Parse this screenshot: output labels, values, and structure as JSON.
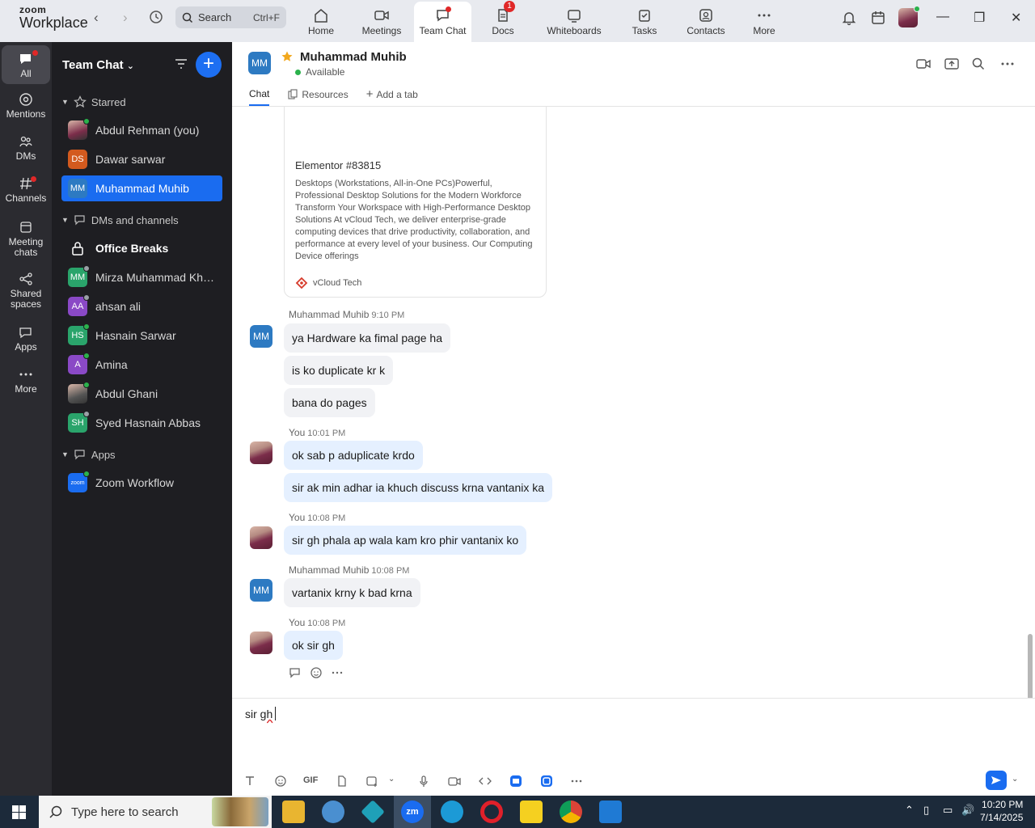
{
  "app": {
    "logo_top": "zoom",
    "logo_bottom": "Workplace"
  },
  "search": {
    "label": "Search",
    "shortcut": "Ctrl+F"
  },
  "nav": {
    "home": "Home",
    "meetings": "Meetings",
    "team_chat": "Team Chat",
    "docs": "Docs",
    "docs_badge": "1",
    "whiteboards": "Whiteboards",
    "tasks": "Tasks",
    "contacts": "Contacts",
    "more": "More"
  },
  "rail": {
    "all": "All",
    "mentions": "Mentions",
    "dms": "DMs",
    "channels": "Channels",
    "meeting_chats": "Meeting chats",
    "shared_spaces": "Shared spaces",
    "apps": "Apps",
    "more": "More"
  },
  "sidebar": {
    "title": "Team Chat",
    "starred_label": "Starred",
    "dms_label": "DMs and channels",
    "apps_label": "Apps",
    "starred": [
      {
        "initials": "",
        "name": "Abdul Rehman (you)",
        "color": "#7b2d4a",
        "status": "#2bb24c"
      },
      {
        "initials": "DS",
        "name": "Dawar sarwar",
        "color": "#d35a1e",
        "status": ""
      },
      {
        "initials": "MM",
        "name": "Muhammad Muhib",
        "color": "#2d7ac2",
        "status": ""
      }
    ],
    "dms": [
      {
        "initials": "",
        "name": "Office Breaks",
        "color": "",
        "status": ""
      },
      {
        "initials": "MM",
        "name": "Mirza Muhammad Khurram",
        "color": "#2aa46b",
        "status": "#9aa0a6"
      },
      {
        "initials": "AA",
        "name": "ahsan ali",
        "color": "#8a49c6",
        "status": "#9aa0a6"
      },
      {
        "initials": "HS",
        "name": "Hasnain Sarwar",
        "color": "#2aa46b",
        "status": "#2bb24c"
      },
      {
        "initials": "A",
        "name": "Amina",
        "color": "#8a49c6",
        "status": "#2bb24c"
      },
      {
        "initials": "",
        "name": "Abdul Ghani",
        "color": "#555",
        "status": "#2bb24c"
      },
      {
        "initials": "SH",
        "name": "Syed Hasnain Abbas",
        "color": "#2aa46b",
        "status": "#9aa0a6"
      }
    ],
    "apps": [
      {
        "initials": "zoom",
        "name": "Zoom Workflow",
        "color": "#1a6cf0",
        "status": "#2bb24c"
      }
    ]
  },
  "channel": {
    "initials": "MM",
    "name": "Muhammad Muhib",
    "status": "Available",
    "tabs": {
      "chat": "Chat",
      "resources": "Resources",
      "add_tab": "Add a tab"
    }
  },
  "card": {
    "title": "Elementor #83815",
    "description": "Desktops (Workstations, All-in-One PCs)Powerful, Professional Desktop Solutions for the Modern Workforce Transform Your Workspace with High-Performance Desktop Solutions At vCloud Tech, we deliver enterprise-grade computing devices that drive productivity, collaboration, and performance at every level of your business. Our Computing Device offerings",
    "source": "vCloud Tech"
  },
  "messages": [
    {
      "sender": "Muhammad Muhib",
      "time": "9:10 PM",
      "lines": [
        "ya Hardware ka fimal page ha",
        "is ko duplicate kr k",
        "bana do pages"
      ]
    },
    {
      "sender": "You",
      "time": "10:01 PM",
      "lines": [
        "ok sab p aduplicate krdo",
        "sir ak min adhar ia khuch discuss krna vantanix ka"
      ]
    },
    {
      "sender": "You",
      "time": "10:08 PM",
      "lines": [
        "sir gh phala ap wala kam kro phir vantanix ko"
      ]
    },
    {
      "sender": "Muhammad Muhib",
      "time": "10:08 PM",
      "lines": [
        "vartanix krny k bad krna"
      ]
    },
    {
      "sender": "You",
      "time": "10:08 PM",
      "lines": [
        "ok sir gh"
      ]
    }
  ],
  "composer": {
    "text_a": "sir ",
    "text_b": "gh"
  },
  "toolbar": {
    "gif": "GIF"
  },
  "taskbar": {
    "search_placeholder": "Type here to search",
    "time": "10:20 PM",
    "date": "7/14/2025"
  },
  "colors": {
    "accent": "#1a6cf0",
    "sidebar_bg": "#1e1e22",
    "rail_bg": "#2b2b30",
    "online": "#2bb24c"
  }
}
